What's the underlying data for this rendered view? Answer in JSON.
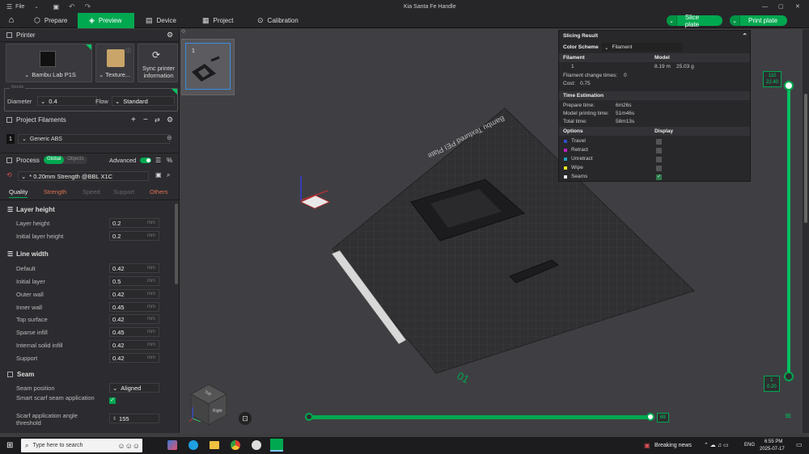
{
  "window": {
    "title": "Kia Santa Fe Handle",
    "file_menu": "File"
  },
  "tabs": [
    {
      "label": "Prepare"
    },
    {
      "label": "Preview"
    },
    {
      "label": "Device"
    },
    {
      "label": "Project"
    },
    {
      "label": "Calibration"
    }
  ],
  "actions": {
    "slice_label": "Slice plate",
    "print_label": "Print plate"
  },
  "printer": {
    "header": "Printer",
    "name": "Bambu Lab P1S",
    "plate": "Texture...",
    "sync_label": "Sync printer information",
    "nozzle_label": "Nozzle",
    "diameter_label": "Diameter",
    "diameter_value": "0.4",
    "flow_label": "Flow",
    "flow_value": "Standard"
  },
  "filaments": {
    "header": "Project Filaments",
    "items": [
      {
        "index": "1",
        "name": "Generic ABS"
      }
    ]
  },
  "process": {
    "header": "Process",
    "toggle_global": "Global",
    "toggle_objects": "Objects",
    "advanced_label": "Advanced",
    "preset": "* 0.20mm Strength @BBL X1C",
    "tabs": [
      "Quality",
      "Strength",
      "Speed",
      "Support",
      "Others"
    ]
  },
  "layer_height": {
    "header": "Layer height",
    "rows": [
      {
        "label": "Layer height",
        "value": "0.2",
        "unit": "mm"
      },
      {
        "label": "Initial layer height",
        "value": "0.2",
        "unit": "mm"
      }
    ]
  },
  "line_width": {
    "header": "Line width",
    "rows": [
      {
        "label": "Default",
        "value": "0.42",
        "unit": "mm"
      },
      {
        "label": "Initial layer",
        "value": "0.5",
        "unit": "mm"
      },
      {
        "label": "Outer wall",
        "value": "0.42",
        "unit": "mm"
      },
      {
        "label": "Inner wall",
        "value": "0.45",
        "unit": "mm"
      },
      {
        "label": "Top surface",
        "value": "0.42",
        "unit": "mm"
      },
      {
        "label": "Sparse infill",
        "value": "0.45",
        "unit": "mm"
      },
      {
        "label": "Internal solid infill",
        "value": "0.42",
        "unit": "mm"
      },
      {
        "label": "Support",
        "value": "0.42",
        "unit": "mm"
      }
    ]
  },
  "seam": {
    "header": "Seam",
    "position_label": "Seam position",
    "position_value": "Aligned",
    "scarf_label": "Smart scarf seam application",
    "scarf_checked": true,
    "angle_label": "Scarf application angle threshold",
    "angle_value": "155"
  },
  "plate": {
    "thumb_number": "1",
    "bed_text": "Bambu Textured PEI Plate",
    "bed_number": "01"
  },
  "slicing_result": {
    "title": "Slicing Result",
    "color_scheme_label": "Color Scheme",
    "color_scheme_value": "Filament",
    "col_filament": "Filament",
    "col_model": "Model",
    "row_index": "1",
    "row_length": "8.19 m",
    "row_weight": "25.03 g",
    "change_times_label": "Filament change times:",
    "change_times_value": "0",
    "cost_label": "Cost:",
    "cost_value": "0.75",
    "time_header": "Time Estimation",
    "prepare_label": "Prepare time:",
    "prepare_value": "6m26s",
    "model_time_label": "Model printing time:",
    "model_time_value": "51m46s",
    "total_label": "Total time:",
    "total_value": "58m13s",
    "options_label": "Options",
    "display_label": "Display",
    "options": [
      {
        "label": "Travel",
        "color": "#3050c8",
        "checked": false
      },
      {
        "label": "Retract",
        "color": "#c020c0",
        "checked": false
      },
      {
        "label": "Unretract",
        "color": "#20a0c0",
        "checked": false
      },
      {
        "label": "Wipe",
        "color": "#e8e820",
        "checked": false
      },
      {
        "label": "Seams",
        "color": "#e8e8e8",
        "checked": true
      }
    ]
  },
  "layer_slider": {
    "top_layer": "110",
    "top_height": "22.40",
    "bottom_layer": "1",
    "bottom_height": "0.20"
  },
  "move_slider": {
    "value": "69"
  },
  "nav_cube": {
    "top": "Top",
    "right": "Right"
  },
  "taskbar": {
    "search_placeholder": "Type here to search",
    "news": "Breaking news",
    "lang": "ENG",
    "time": "6:55 PM",
    "date": "2025-07-17"
  },
  "colors": {
    "accent": "#00a84f",
    "panel": "#2c2c30",
    "viewport": "#3f3f43"
  }
}
